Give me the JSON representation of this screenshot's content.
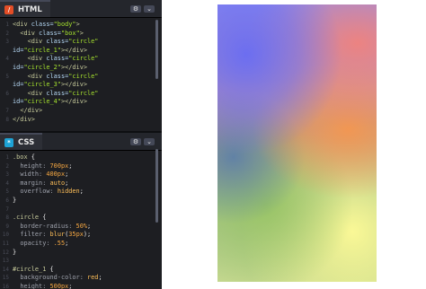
{
  "html_pane": {
    "title": "HTML",
    "icon": "html-logo-icon",
    "lines": [
      {
        "n": "1",
        "segs": [
          [
            "tag",
            "<div "
          ],
          [
            "attr",
            "class="
          ],
          [
            "str",
            "\"body\""
          ],
          [
            "tag",
            ">"
          ]
        ]
      },
      {
        "n": "2",
        "segs": [
          [
            "txt",
            "  "
          ],
          [
            "tag",
            "<div "
          ],
          [
            "attr",
            "class="
          ],
          [
            "str",
            "\"box\""
          ],
          [
            "tag",
            ">"
          ]
        ]
      },
      {
        "n": "3",
        "segs": [
          [
            "txt",
            "    "
          ],
          [
            "tag",
            "<div "
          ],
          [
            "attr",
            "class="
          ],
          [
            "str",
            "\"circle\""
          ]
        ]
      },
      {
        "n": "",
        "segs": [
          [
            "attr",
            "id="
          ],
          [
            "str",
            "\"circle_1\""
          ],
          [
            "tag",
            "></div>"
          ]
        ]
      },
      {
        "n": "4",
        "segs": [
          [
            "txt",
            "    "
          ],
          [
            "tag",
            "<div "
          ],
          [
            "attr",
            "class="
          ],
          [
            "str",
            "\"circle\""
          ]
        ]
      },
      {
        "n": "",
        "segs": [
          [
            "attr",
            "id="
          ],
          [
            "str",
            "\"circle_2\""
          ],
          [
            "tag",
            "></div>"
          ]
        ]
      },
      {
        "n": "5",
        "segs": [
          [
            "txt",
            "    "
          ],
          [
            "tag",
            "<div "
          ],
          [
            "attr",
            "class="
          ],
          [
            "str",
            "\"circle\""
          ]
        ]
      },
      {
        "n": "",
        "segs": [
          [
            "attr",
            "id="
          ],
          [
            "str",
            "\"circle_3\""
          ],
          [
            "tag",
            "></div>"
          ]
        ]
      },
      {
        "n": "6",
        "segs": [
          [
            "txt",
            "    "
          ],
          [
            "tag",
            "<div "
          ],
          [
            "attr",
            "class="
          ],
          [
            "str",
            "\"circle\""
          ]
        ]
      },
      {
        "n": "",
        "segs": [
          [
            "attr",
            "id="
          ],
          [
            "str",
            "\"circle_4\""
          ],
          [
            "tag",
            "></div>"
          ]
        ]
      },
      {
        "n": "7",
        "segs": [
          [
            "txt",
            "  "
          ],
          [
            "tag",
            "</div>"
          ]
        ]
      },
      {
        "n": "8",
        "segs": [
          [
            "tag",
            "</div>"
          ]
        ]
      }
    ]
  },
  "css_pane": {
    "title": "CSS",
    "icon": "css-logo-icon",
    "lines": [
      {
        "n": "1",
        "segs": [
          [
            "sel",
            ".box "
          ],
          [
            "pun",
            "{"
          ]
        ]
      },
      {
        "n": "2",
        "segs": [
          [
            "txt",
            "  "
          ],
          [
            "prop",
            "height: "
          ],
          [
            "num",
            "700px"
          ],
          [
            "pun",
            ";"
          ]
        ]
      },
      {
        "n": "3",
        "segs": [
          [
            "txt",
            "  "
          ],
          [
            "prop",
            "width: "
          ],
          [
            "num",
            "400px"
          ],
          [
            "pun",
            ";"
          ]
        ]
      },
      {
        "n": "4",
        "segs": [
          [
            "txt",
            "  "
          ],
          [
            "prop",
            "margin: "
          ],
          [
            "kw",
            "auto"
          ],
          [
            "pun",
            ";"
          ]
        ]
      },
      {
        "n": "5",
        "segs": [
          [
            "txt",
            "  "
          ],
          [
            "prop",
            "overflow: "
          ],
          [
            "kw",
            "hidden"
          ],
          [
            "pun",
            ";"
          ]
        ]
      },
      {
        "n": "6",
        "segs": [
          [
            "pun",
            "}"
          ]
        ]
      },
      {
        "n": "7",
        "segs": []
      },
      {
        "n": "8",
        "segs": [
          [
            "sel",
            ".circle "
          ],
          [
            "pun",
            "{"
          ]
        ]
      },
      {
        "n": "9",
        "segs": [
          [
            "txt",
            "  "
          ],
          [
            "prop",
            "border-radius: "
          ],
          [
            "num",
            "50%"
          ],
          [
            "pun",
            ";"
          ]
        ]
      },
      {
        "n": "10",
        "segs": [
          [
            "txt",
            "  "
          ],
          [
            "prop",
            "filter: "
          ],
          [
            "kw",
            "blur"
          ],
          [
            "pun",
            "("
          ],
          [
            "num",
            "35px"
          ],
          [
            "pun",
            ");"
          ]
        ]
      },
      {
        "n": "11",
        "segs": [
          [
            "txt",
            "  "
          ],
          [
            "prop",
            "opacity: "
          ],
          [
            "num",
            ".55"
          ],
          [
            "pun",
            ";"
          ]
        ]
      },
      {
        "n": "12",
        "segs": [
          [
            "pun",
            "}"
          ]
        ]
      },
      {
        "n": "13",
        "segs": []
      },
      {
        "n": "14",
        "segs": [
          [
            "sel",
            "#circle_1 "
          ],
          [
            "pun",
            "{"
          ]
        ]
      },
      {
        "n": "15",
        "segs": [
          [
            "txt",
            "  "
          ],
          [
            "prop",
            "background-color: "
          ],
          [
            "kw",
            "red"
          ],
          [
            "pun",
            ";"
          ]
        ]
      },
      {
        "n": "16",
        "segs": [
          [
            "txt",
            "  "
          ],
          [
            "prop",
            "height: "
          ],
          [
            "num",
            "500px"
          ],
          [
            "pun",
            ";"
          ]
        ]
      }
    ]
  },
  "pane_controls": {
    "settings_icon": "gear-icon",
    "collapse_icon": "chevron-down-icon",
    "settings_glyph": "⚙",
    "collapse_glyph": "⌄"
  },
  "preview": {
    "colors": {
      "blue": "#6c6ef0",
      "salmon": "#f0827d",
      "orange": "#f49650",
      "slate": "#5a7daa",
      "green": "#96c364",
      "yellow": "#faf896"
    }
  }
}
